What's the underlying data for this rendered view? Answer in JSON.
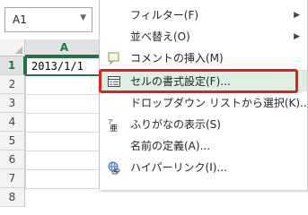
{
  "name_box": {
    "value": "A1"
  },
  "grid": {
    "columns": [
      "A",
      ""
    ],
    "rows": [
      "1",
      "2",
      "3",
      "4",
      "5",
      "6",
      "7",
      "8"
    ],
    "cell_a1": "2013/1/1"
  },
  "context_menu": {
    "items": [
      {
        "label": "フィルター(F)",
        "has_submenu": true
      },
      {
        "label": "並べ替え(O)",
        "has_submenu": true
      },
      {
        "label": "コメントの挿入(M)"
      },
      {
        "label": "セルの書式設定(F)..."
      },
      {
        "label": "ドロップダウン リストから選択(K)..."
      },
      {
        "label": "ふりがなの表示(S)"
      },
      {
        "label": "名前の定義(A)..."
      },
      {
        "label": "ハイパーリンク(I)..."
      }
    ]
  },
  "colors": {
    "accent": "#217346",
    "highlight": "#dcefe1",
    "annotation": "#e02020"
  }
}
